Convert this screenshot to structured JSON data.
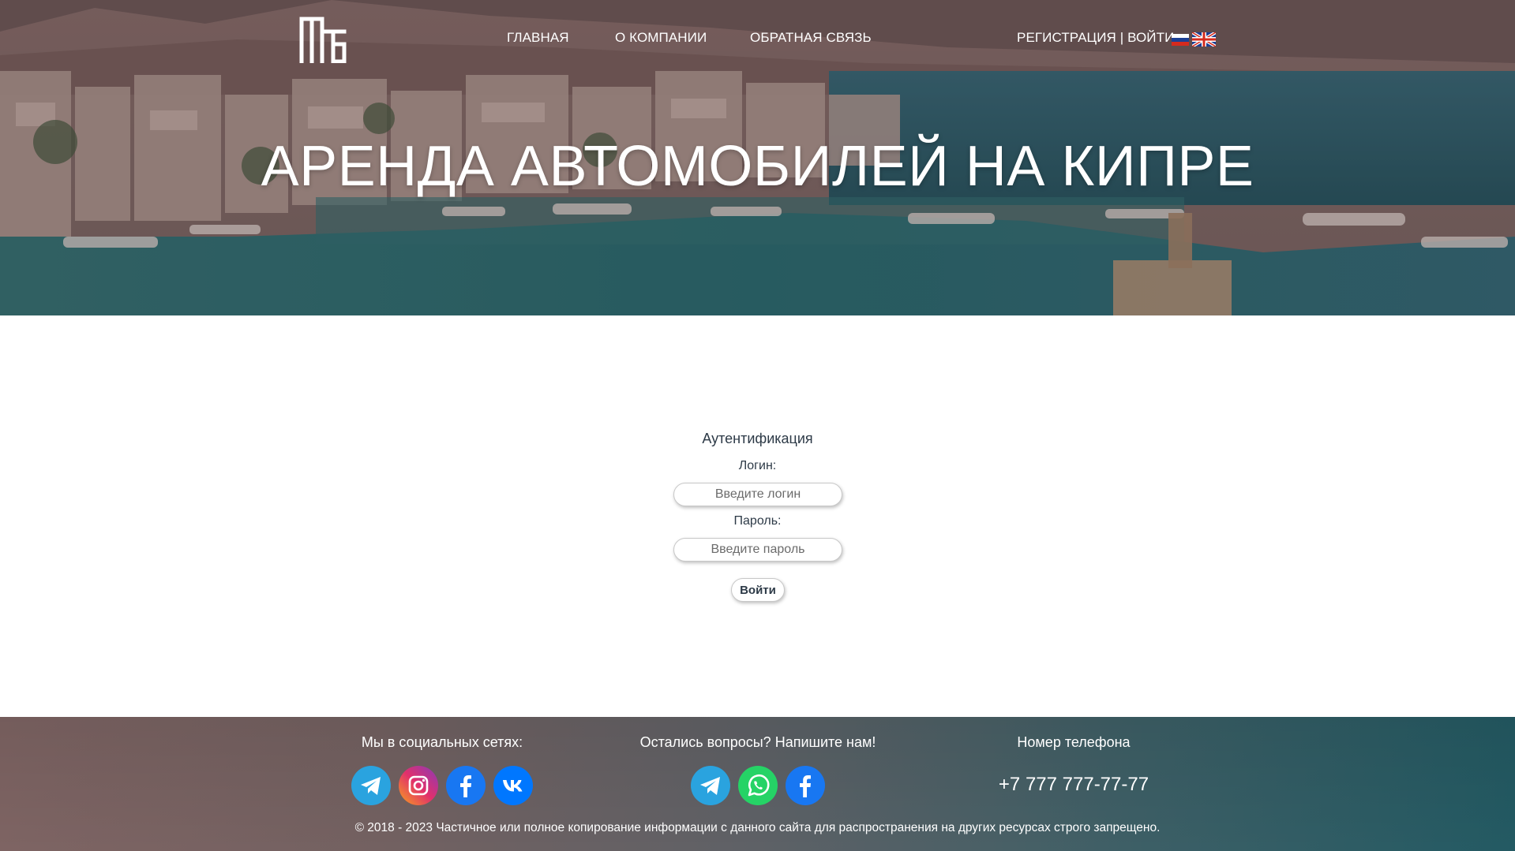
{
  "header": {
    "logo_name": "logo-icon",
    "nav": {
      "home": "ГЛАВНАЯ",
      "about": "О КОМПАНИИ",
      "feedback": "ОБРАТНАЯ СВЯЗЬ",
      "auth": "РЕГИСТРАЦИЯ | ВОЙТИ"
    },
    "languages": [
      "ru",
      "en"
    ]
  },
  "hero": {
    "title": "АРЕНДА АВТОМОБИЛЕЙ НА КИПРЕ"
  },
  "auth": {
    "heading": "Аутентификация",
    "login_label": "Логин:",
    "login_placeholder": "Введите логин",
    "password_label": "Пароль:",
    "password_placeholder": "Введите пароль",
    "submit_label": "Войти"
  },
  "footer": {
    "social_title": "Мы в социальных сетях:",
    "social_icons": [
      "telegram-icon",
      "instagram-icon",
      "facebook-icon",
      "vk-icon"
    ],
    "contact_title": "Остались вопросы? Напишите нам!",
    "contact_icons": [
      "telegram-icon",
      "whatsapp-icon",
      "facebook-icon"
    ],
    "phone_title": "Номер телефона",
    "phone": "+7 777 777-77-77",
    "copyright": "© 2018 - 2023 Частичное или полное копирование информации с данного сайта для распространения на других ресурсах строго запрещено."
  },
  "colors": {
    "telegram": "#2aa3df",
    "instagram_start": "#f9a21c",
    "instagram_end": "#8a3ab9",
    "facebook": "#1877f2",
    "vk": "#0077ff",
    "whatsapp": "#25d366",
    "text_dark": "#2d3a47"
  }
}
